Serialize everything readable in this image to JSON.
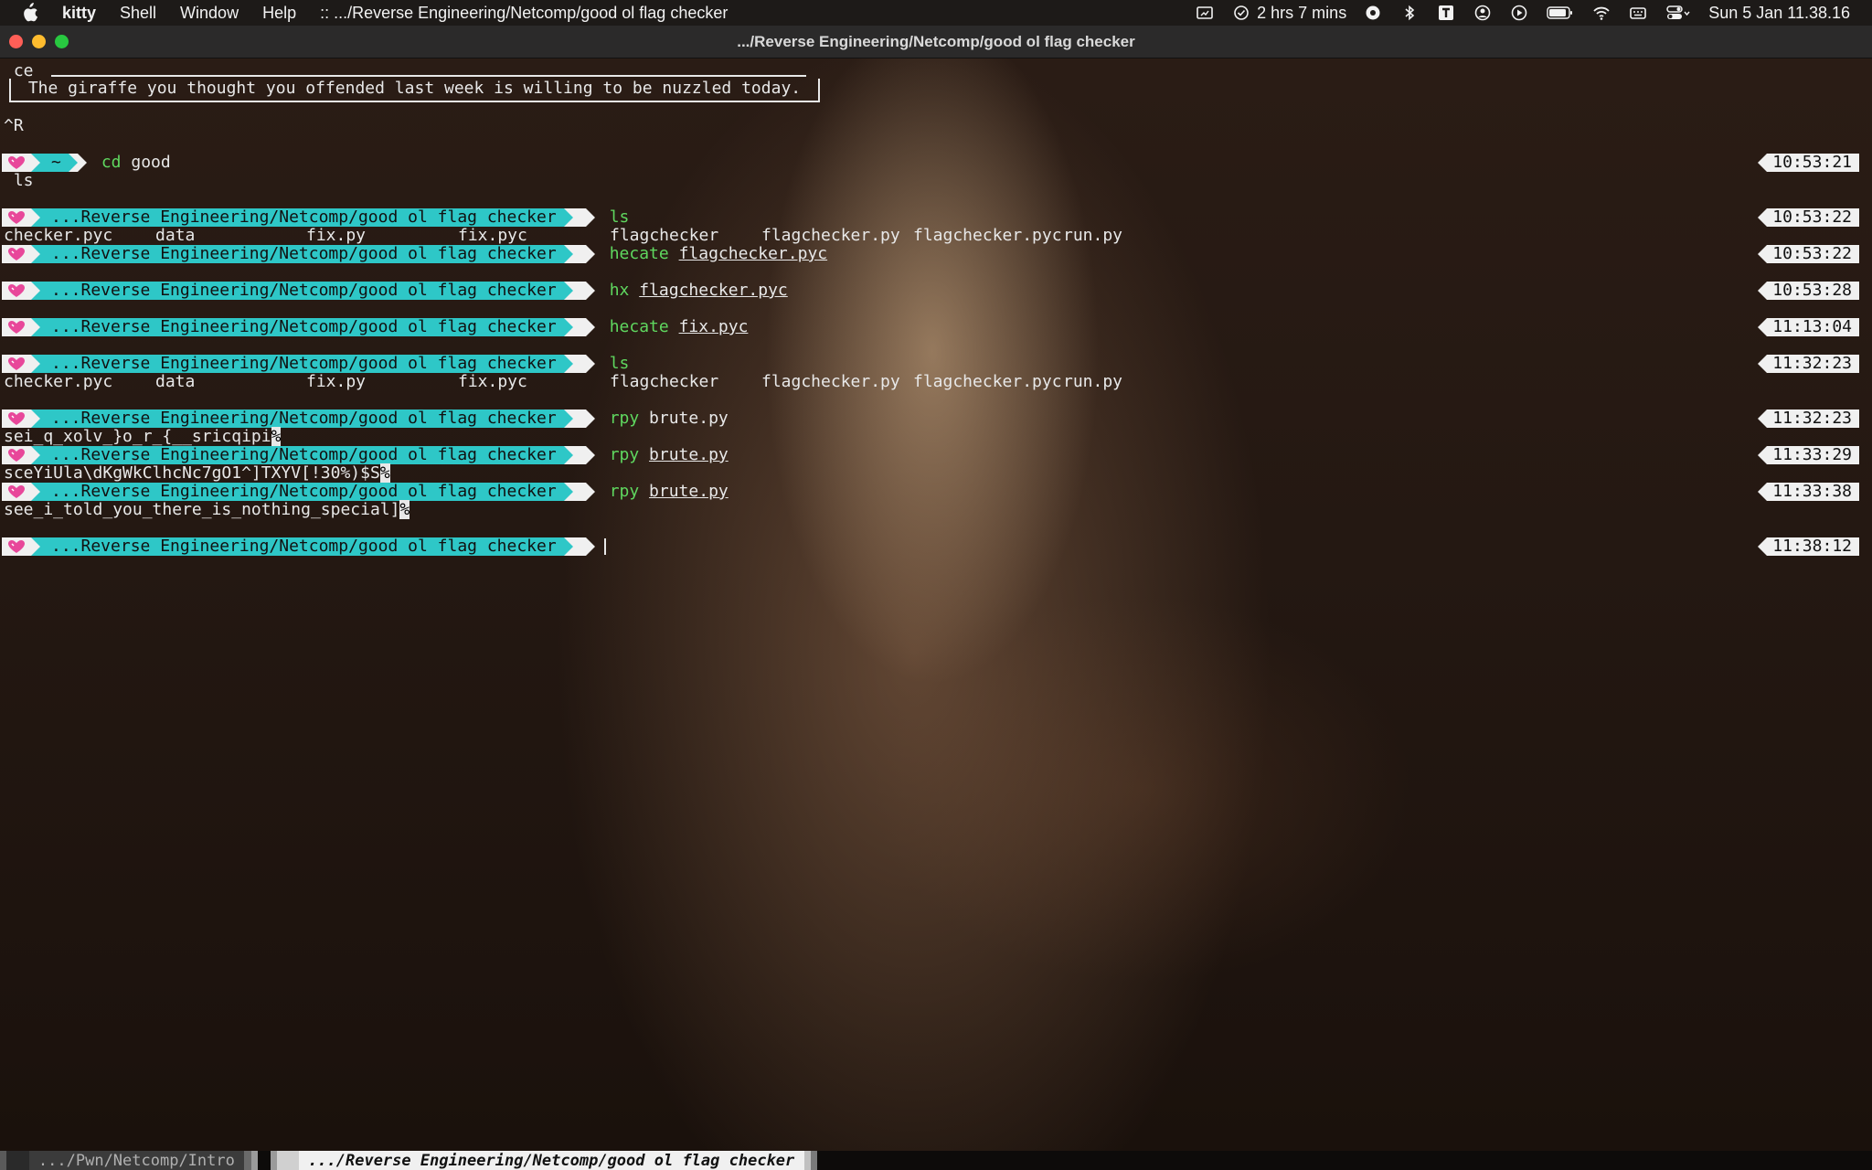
{
  "menubar": {
    "app_name": "kitty",
    "items": [
      "Shell",
      "Window",
      "Help"
    ],
    "window_title": ":: .../Reverse Engineering/Netcomp/good ol flag checker",
    "battery_time": "2 hrs 7 mins",
    "clock": "Sun 5 Jan  11.38.16"
  },
  "window": {
    "title": ".../Reverse Engineering/Netcomp/good ol flag checker"
  },
  "terminal": {
    "pre_line_1": " ce",
    "fortune": " The giraffe you thought you offended last week is willing to be nuzzled today. ",
    "pre_line_2": "^R",
    "home_prompt": {
      "path": "~",
      "command": "cd",
      "arg": "good",
      "time": "10:53:21"
    },
    "pre_ls": " ls",
    "prompt_path": "...Reverse Engineering/Netcomp/good ol flag checker",
    "commands": [
      {
        "cmd": "ls",
        "arg": "",
        "time": "10:53:22"
      },
      {
        "cmd": "hecate",
        "arg": "flagchecker.pyc",
        "time": "10:53:22"
      },
      {
        "cmd": "hx",
        "arg": "flagchecker.pyc",
        "time": "10:53:28"
      },
      {
        "cmd": "hecate",
        "arg": "fix.pyc",
        "time": "11:13:04"
      },
      {
        "cmd": "ls",
        "arg": "",
        "time": "11:32:23"
      },
      {
        "cmd": "rpy",
        "arg": "brute.py",
        "time": "11:32:23"
      },
      {
        "cmd": "rpy",
        "arg": "brute.py",
        "time": "11:33:29"
      },
      {
        "cmd": "rpy",
        "arg": "brute.py",
        "time": "11:33:38"
      },
      {
        "cmd": "",
        "arg": "",
        "time": "11:38:12"
      }
    ],
    "ls_files": [
      "checker.pyc",
      "data",
      "fix.py",
      "fix.pyc",
      "flagchecker",
      "flagchecker.py",
      "flagchecker.pyc",
      "run.py"
    ],
    "outputs": [
      {
        "text": "sei_q_xolv_}o_r_{__sricqipi",
        "end": "%"
      },
      {
        "text": "sceYiUla\\dKgWkClhcNc7gO1^]TXYV[!30%)$S",
        "end": "%"
      },
      {
        "text": "see_i_told_you_there_is_nothing_special]",
        "end": "%"
      }
    ]
  },
  "tabs": [
    {
      "label": " .../Pwn/Netcomp/Intro ",
      "active": false
    },
    {
      "label": " .../Reverse Engineering/Netcomp/good ol flag checker ",
      "active": true
    }
  ],
  "colors": {
    "prompt_path_bg": "#2ec7c7",
    "command_green": "#5fd75f",
    "heart": "#e8479a"
  }
}
